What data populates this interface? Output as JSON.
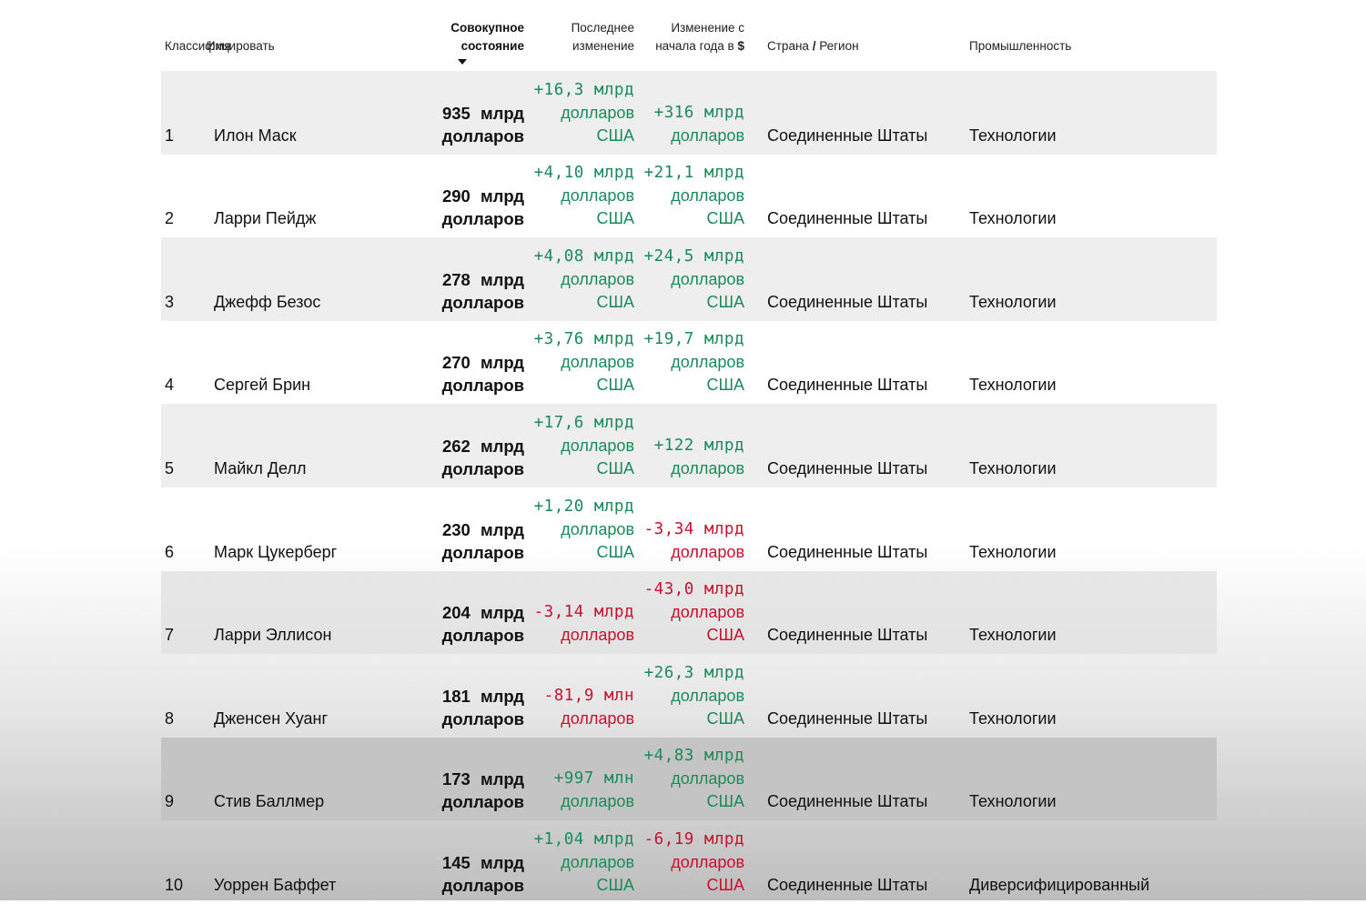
{
  "header": {
    "rank": "Классифицировать",
    "name": "Имя",
    "worth_line1": "Совокупное",
    "worth_line2": "состояние",
    "last_line1": "Последнее",
    "last_line2": "изменение",
    "ytd_line1": "Изменение с",
    "ytd_line2": "начала года в",
    "ytd_symbol": "$",
    "country": "Страна",
    "country_sep": "/",
    "region": "Регион",
    "industry": "Промышленность"
  },
  "sort": {
    "column": "Совокупное состояние",
    "direction": "descending"
  },
  "colors": {
    "positive": "#1b8a5a",
    "negative": "#c8102e"
  },
  "rows": [
    {
      "rank": "1",
      "name": "Илон Маск",
      "worth": [
        "935 млрд",
        "долларов"
      ],
      "last": [
        "+16,3 млрд",
        "долларов",
        "США"
      ],
      "last_sign": "pos",
      "ytd": [
        "+316 млрд",
        "долларов"
      ],
      "ytd_sign": "pos",
      "country": "Соединенные Штаты",
      "industry": "Технологии"
    },
    {
      "rank": "2",
      "name": "Ларри Пейдж",
      "worth": [
        "290 млрд",
        "долларов"
      ],
      "last": [
        "+4,10 млрд",
        "долларов",
        "США"
      ],
      "last_sign": "pos",
      "ytd": [
        "+21,1 млрд",
        "долларов",
        "США"
      ],
      "ytd_sign": "pos",
      "country": "Соединенные Штаты",
      "industry": "Технологии"
    },
    {
      "rank": "3",
      "name": "Джефф Безос",
      "worth": [
        "278 млрд",
        "долларов"
      ],
      "last": [
        "+4,08 млрд",
        "долларов",
        "США"
      ],
      "last_sign": "pos",
      "ytd": [
        "+24,5 млрд",
        "долларов",
        "США"
      ],
      "ytd_sign": "pos",
      "country": "Соединенные Штаты",
      "industry": "Технологии"
    },
    {
      "rank": "4",
      "name": "Сергей Брин",
      "worth": [
        "270 млрд",
        "долларов"
      ],
      "last": [
        "+3,76 млрд",
        "долларов",
        "США"
      ],
      "last_sign": "pos",
      "ytd": [
        "+19,7 млрд",
        "долларов",
        "США"
      ],
      "ytd_sign": "pos",
      "country": "Соединенные Штаты",
      "industry": "Технологии"
    },
    {
      "rank": "5",
      "name": "Майкл Делл",
      "worth": [
        "262 млрд",
        "долларов"
      ],
      "last": [
        "+17,6 млрд",
        "долларов",
        "США"
      ],
      "last_sign": "pos",
      "ytd": [
        "+122 млрд",
        "долларов"
      ],
      "ytd_sign": "pos",
      "country": "Соединенные Штаты",
      "industry": "Технологии"
    },
    {
      "rank": "6",
      "name": "Марк Цукерберг",
      "worth": [
        "230 млрд",
        "долларов"
      ],
      "last": [
        "+1,20 млрд",
        "долларов",
        "США"
      ],
      "last_sign": "pos",
      "ytd": [
        "-3,34 млрд",
        "долларов"
      ],
      "ytd_sign": "neg",
      "country": "Соединенные Штаты",
      "industry": "Технологии"
    },
    {
      "rank": "7",
      "name": "Ларри Эллисон",
      "worth": [
        "204 млрд",
        "долларов"
      ],
      "last": [
        "-3,14 млрд",
        "долларов"
      ],
      "last_sign": "neg",
      "ytd": [
        "-43,0 млрд",
        "долларов",
        "США"
      ],
      "ytd_sign": "neg",
      "country": "Соединенные Штаты",
      "industry": "Технологии"
    },
    {
      "rank": "8",
      "name": "Дженсен Хуанг",
      "worth": [
        "181 млрд",
        "долларов"
      ],
      "last": [
        "-81,9 млн",
        "долларов"
      ],
      "last_sign": "neg",
      "ytd": [
        "+26,3 млрд",
        "долларов",
        "США"
      ],
      "ytd_sign": "pos",
      "country": "Соединенные Штаты",
      "industry": "Технологии"
    },
    {
      "rank": "9",
      "name": "Стив Баллмер",
      "worth": [
        "173 млрд",
        "долларов"
      ],
      "last": [
        "+997 млн",
        "долларов"
      ],
      "last_sign": "pos",
      "ytd": [
        "+4,83 млрд",
        "долларов",
        "США"
      ],
      "ytd_sign": "pos",
      "country": "Соединенные Штаты",
      "industry": "Технологии"
    },
    {
      "rank": "10",
      "name": "Уоррен Баффет",
      "worth": [
        "145 млрд",
        "долларов"
      ],
      "last": [
        "+1,04 млрд",
        "долларов",
        "США"
      ],
      "last_sign": "pos",
      "ytd": [
        "-6,19 млрд",
        "долларов",
        "США"
      ],
      "ytd_sign": "neg",
      "country": "Соединенные Штаты",
      "industry": "Диверсифицированный"
    }
  ]
}
